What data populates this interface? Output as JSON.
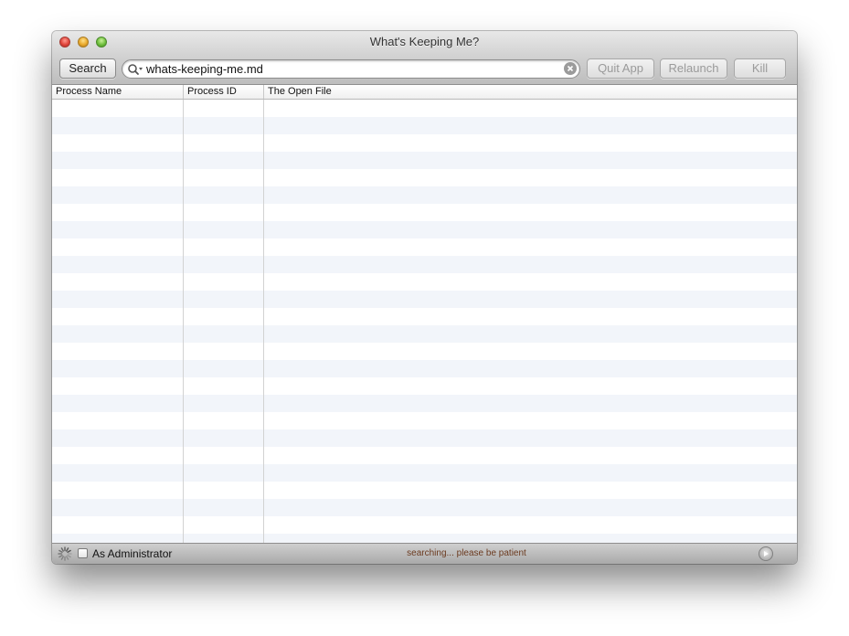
{
  "window": {
    "title": "What's Keeping Me?"
  },
  "toolbar": {
    "search_label": "Search",
    "search_value": "whats-keeping-me.md",
    "quit_label": "Quit App",
    "relaunch_label": "Relaunch",
    "kill_label": "Kill"
  },
  "table": {
    "columns": [
      "Process Name",
      "Process ID",
      "The Open File"
    ],
    "rows": [],
    "stripe_color": "#f2f5fa"
  },
  "footer": {
    "admin_label": "As Administrator",
    "admin_checked": false,
    "status": "searching... please be patient",
    "status_color": "#6b3a1f"
  },
  "icons": {
    "close": "close-icon",
    "minimize": "minimize-icon",
    "zoom": "zoom-icon",
    "search": "search-icon",
    "clear": "clear-icon",
    "spinner": "spinner-icon",
    "play": "play-icon"
  }
}
